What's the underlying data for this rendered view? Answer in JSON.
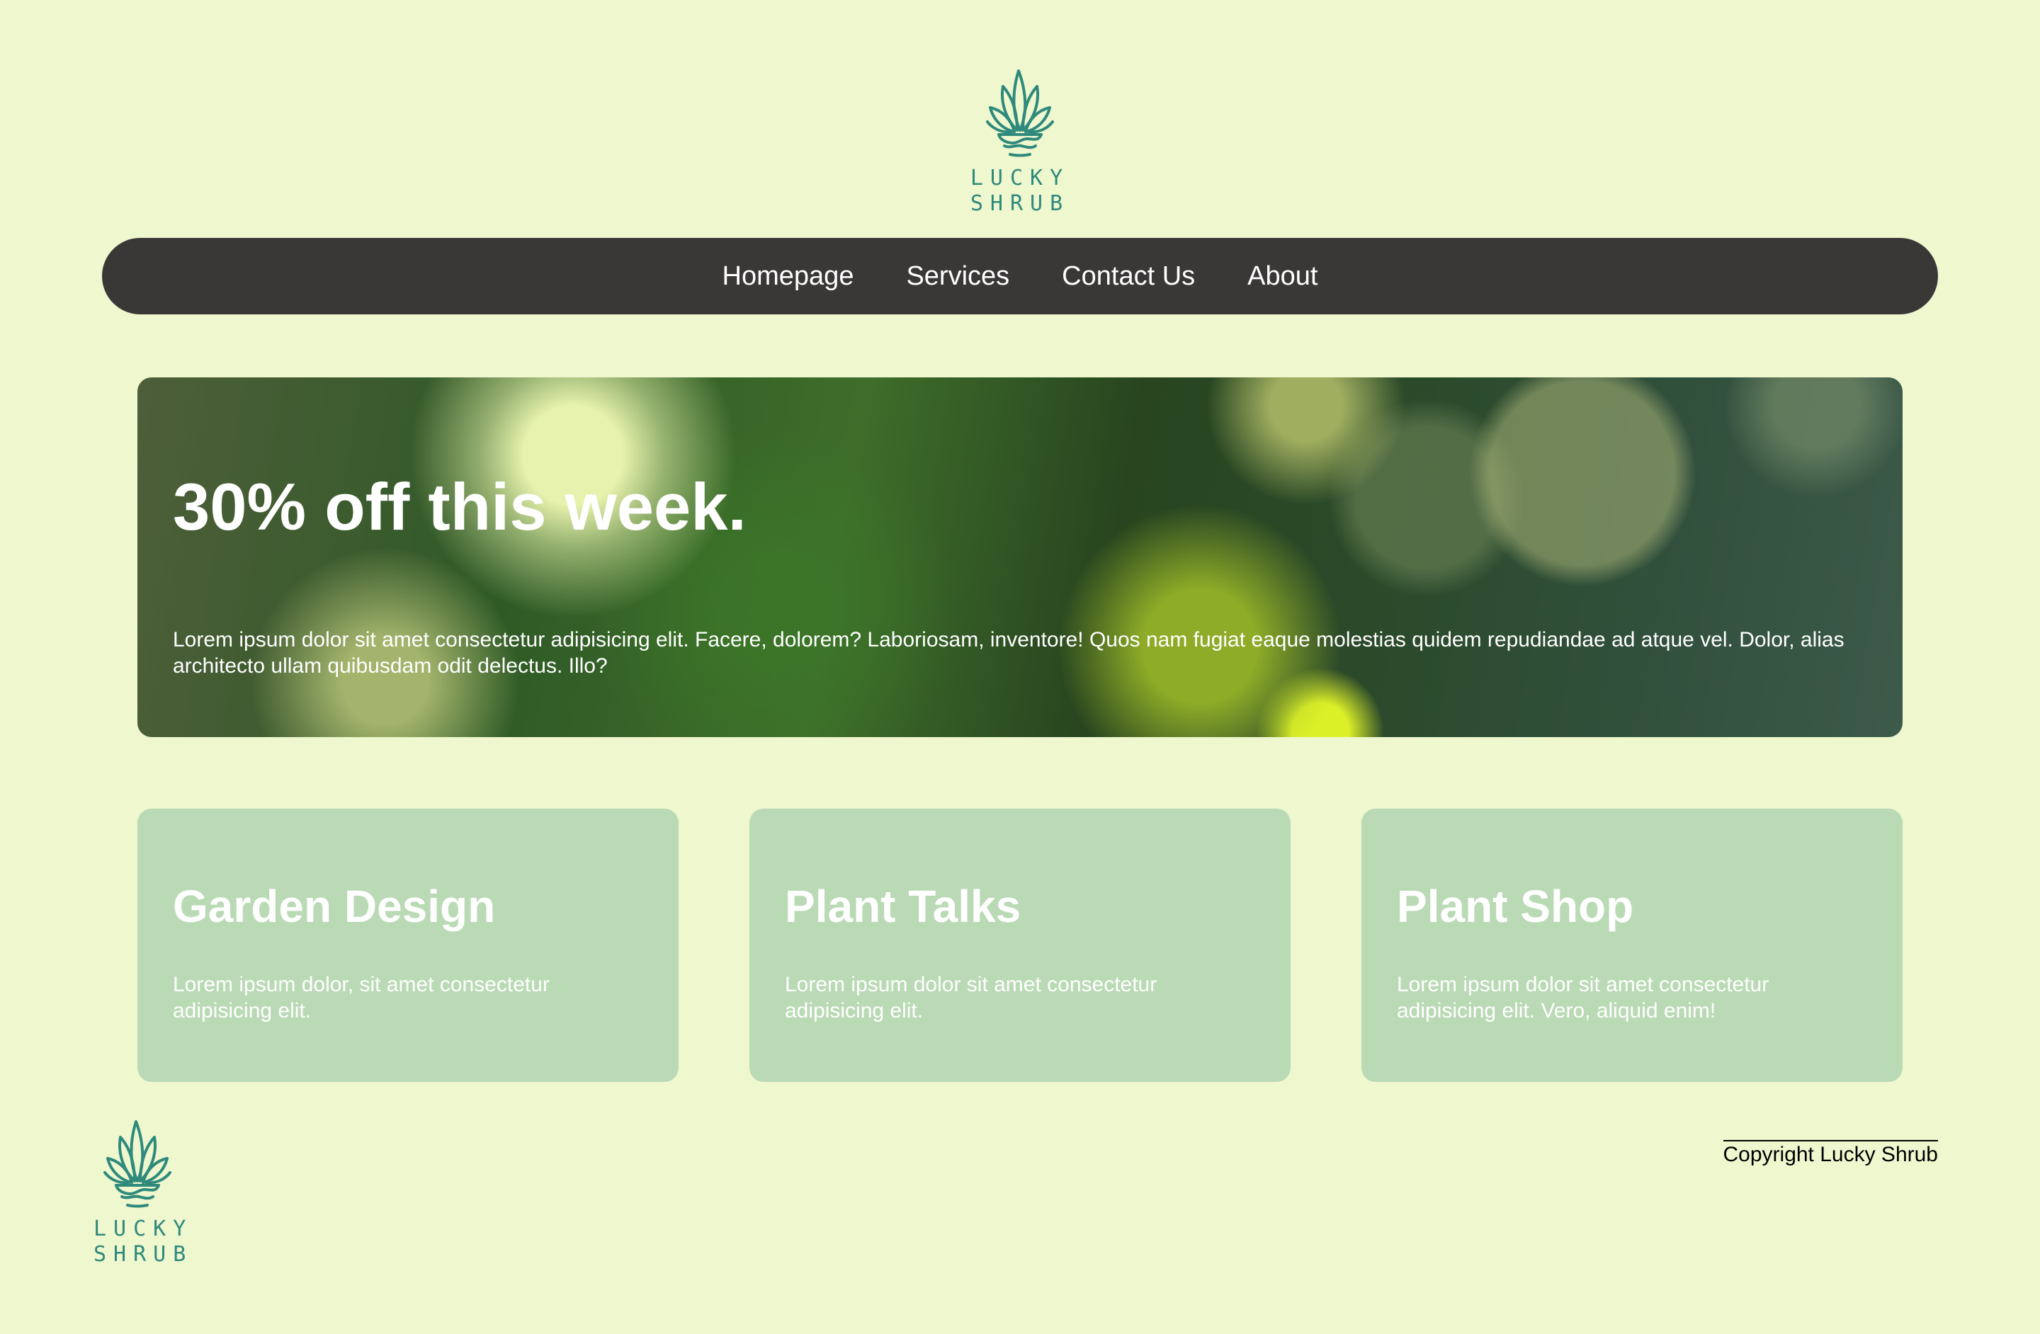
{
  "brand": {
    "logo_line1": "LUCKY",
    "logo_line2": "SHRUB",
    "logo_color": "#2f8a7c"
  },
  "nav": {
    "items": [
      {
        "label": "Homepage"
      },
      {
        "label": "Services"
      },
      {
        "label": "Contact Us"
      },
      {
        "label": "About"
      }
    ]
  },
  "hero": {
    "title": "30% off this week.",
    "body": "Lorem ipsum dolor sit amet consectetur adipisicing elit. Facere, dolorem? Laboriosam, inventore! Quos nam fugiat eaque molestias quidem repudiandae ad atque vel. Dolor, alias architecto ullam quibusdam odit delectus. Illo?"
  },
  "cards": [
    {
      "title": "Garden Design",
      "body": "Lorem ipsum dolor, sit amet consectetur adipisicing elit."
    },
    {
      "title": "Plant Talks",
      "body": "Lorem ipsum dolor sit amet consectetur adipisicing elit."
    },
    {
      "title": "Plant Shop",
      "body": "Lorem ipsum dolor sit amet consectetur adipisicing elit. Vero, aliquid enim!"
    }
  ],
  "footer": {
    "copyright": "Copyright Lucky Shrub"
  },
  "colors": {
    "background": "#eff7cf",
    "nav_background": "#3a3737",
    "card_background": "#badab5"
  }
}
